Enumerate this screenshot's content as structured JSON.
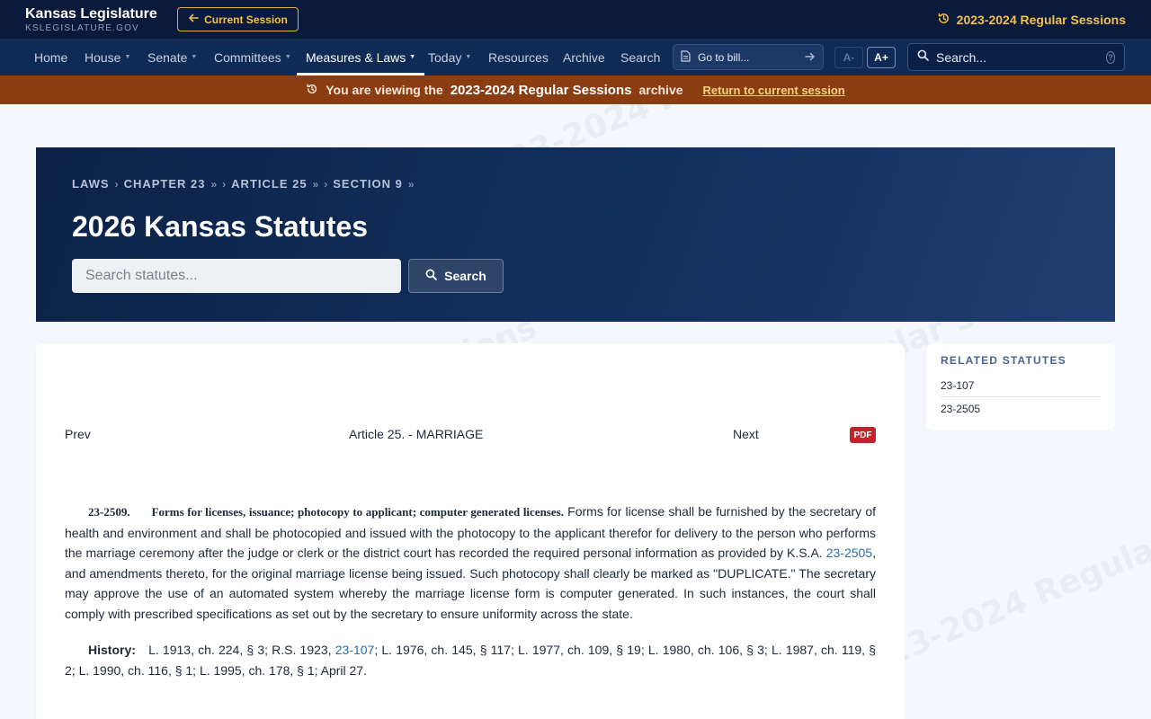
{
  "header": {
    "brand_title": "Kansas Legislature",
    "brand_subtitle": "KSLEGISLATURE.GOV",
    "current_session_label": "Current Session",
    "sessions_label": "2023-2024 Regular Sessions"
  },
  "nav": {
    "items": [
      {
        "label": "Home",
        "dropdown": false
      },
      {
        "label": "House",
        "dropdown": true
      },
      {
        "label": "Senate",
        "dropdown": true
      },
      {
        "label": "Committees",
        "dropdown": true
      },
      {
        "label": "Measures & Laws",
        "dropdown": true,
        "active": true
      },
      {
        "label": "Today",
        "dropdown": true
      },
      {
        "label": "Resources",
        "dropdown": false
      },
      {
        "label": "Archive",
        "dropdown": false
      },
      {
        "label": "Search",
        "dropdown": false
      }
    ],
    "goto_bill_placeholder": "Go to bill...",
    "font_smaller": "A-",
    "font_larger": "A+",
    "search_placeholder": "Search..."
  },
  "banner": {
    "prefix": "You are viewing the",
    "session": "2023-2024 Regular Sessions",
    "suffix": "archive",
    "return_link": "Return to current session"
  },
  "hero": {
    "breadcrumb": [
      "LAWS",
      "CHAPTER 23",
      "ARTICLE 25",
      "SECTION 9"
    ],
    "title": "2026 Kansas Statutes",
    "search_placeholder": "Search statutes...",
    "search_button": "Search"
  },
  "statute": {
    "prev": "Prev",
    "article": "Article 25. - MARRIAGE",
    "next": "Next",
    "pdf": "PDF",
    "section_number": "23-2509.",
    "section_heading": "Forms for licenses, issuance; photocopy to applicant; computer generated licenses.",
    "body_part1": "Forms for license shall be furnished by the secretary of health and environment and shall be photocopied and issued with the photocopy to the applicant therefor for delivery to the person who performs the marriage ceremony after the judge or clerk or the district court has recorded the required personal information as provided by K.S.A. ",
    "body_link": "23-2505",
    "body_part2": ", and amendments thereto, for the original marriage license being issued. Such photocopy shall clearly be marked as \"DUPLICATE.\" The secretary may approve the use of an automated system whereby the marriage license form is computer generated. In such instances, the court shall comply with prescribed specifications as set out by the secretary to ensure uniformity across the state.",
    "history_label": "History:",
    "history_part1": "L. 1913, ch. 224, § 3; R.S. 1923, ",
    "history_link": "23-107",
    "history_part2": "; L. 1976, ch. 145, § 117; L. 1977, ch. 109, § 19; L. 1980, ch. 106, § 3; L. 1987, ch. 119, § 2; L. 1990, ch. 116, § 1; L. 1995, ch. 178, § 1; April 27."
  },
  "related": {
    "title": "RELATED STATUTES",
    "items": [
      "23-107",
      "23-2505"
    ]
  },
  "watermark": "2023-2024 Regular Sessions",
  "colors": {
    "topbar": "#0a1a3a",
    "navbar": "#0f2a55",
    "banner": "#8b3d12",
    "accent_gold": "#f2c04a",
    "link": "#2b6cb0",
    "pdf": "#c4232b"
  }
}
